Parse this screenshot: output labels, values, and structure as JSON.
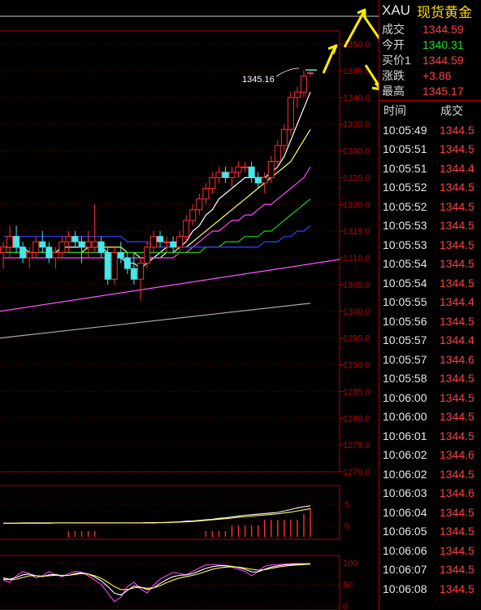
{
  "quote": {
    "code": "XAU",
    "name": "现货黄金",
    "rows": [
      {
        "label": "成交",
        "value": "1344.59",
        "color": "#ff4040"
      },
      {
        "label": "今开",
        "value": "1340.31",
        "color": "#22dd22"
      },
      {
        "label": "买价1",
        "value": "1344.59",
        "color": "#ff4040"
      },
      {
        "label": "涨跌",
        "value": "+3.86",
        "color": "#ff4040"
      },
      {
        "label": "最高",
        "value": "1345.17",
        "color": "#ff4040"
      }
    ]
  },
  "ticks": {
    "col_time": "时间",
    "col_price": "成交",
    "rows": [
      {
        "time": "10:05:49",
        "price": "1344.5"
      },
      {
        "time": "10:05:51",
        "price": "1344.5"
      },
      {
        "time": "10:05:51",
        "price": "1344.4"
      },
      {
        "time": "10:05:52",
        "price": "1344.5"
      },
      {
        "time": "10:05:52",
        "price": "1344.5"
      },
      {
        "time": "10:05:53",
        "price": "1344.5"
      },
      {
        "time": "10:05:53",
        "price": "1344.5"
      },
      {
        "time": "10:05:54",
        "price": "1344.5"
      },
      {
        "time": "10:05:54",
        "price": "1344.5"
      },
      {
        "time": "10:05:55",
        "price": "1344.4"
      },
      {
        "time": "10:05:56",
        "price": "1344.5"
      },
      {
        "time": "10:05:57",
        "price": "1344.4"
      },
      {
        "time": "10:05:57",
        "price": "1344.6"
      },
      {
        "time": "10:05:58",
        "price": "1344.5"
      },
      {
        "time": "10:06:00",
        "price": "1344.5"
      },
      {
        "time": "10:06:00",
        "price": "1344.5"
      },
      {
        "time": "10:06:01",
        "price": "1344.5"
      },
      {
        "time": "10:06:02",
        "price": "1344.6"
      },
      {
        "time": "10:06:02",
        "price": "1344.5"
      },
      {
        "time": "10:06:03",
        "price": "1344.6"
      },
      {
        "time": "10:06:04",
        "price": "1344.5"
      },
      {
        "time": "10:06:05",
        "price": "1344.5"
      },
      {
        "time": "10:06:06",
        "price": "1344.5"
      },
      {
        "time": "10:06:07",
        "price": "1344.5"
      },
      {
        "time": "10:06:08",
        "price": "1344.5"
      }
    ]
  },
  "chart_data": {
    "type": "candlestick",
    "price_axis": {
      "ticks": [
        "1350.0",
        "1345.0",
        "1340.0",
        "1335.0",
        "1330.0",
        "1325.0",
        "1320.0",
        "1315.0",
        "1310.0",
        "1305.0",
        "1300.0",
        "1295.0",
        "1290.0",
        "1285.0",
        "1280.0",
        "1275.0",
        "1270.0"
      ],
      "min": 1270,
      "max": 1350
    },
    "high_annotation": "1345.16",
    "candles": [
      [
        1311,
        1313,
        1308,
        1312
      ],
      [
        1312,
        1316,
        1310,
        1314
      ],
      [
        1314,
        1316,
        1311,
        1312
      ],
      [
        1312,
        1313,
        1309,
        1310
      ],
      [
        1310,
        1312,
        1308,
        1311
      ],
      [
        1311,
        1314,
        1310,
        1313
      ],
      [
        1313,
        1315,
        1311,
        1312
      ],
      [
        1312,
        1313,
        1309,
        1310
      ],
      [
        1310,
        1312,
        1308,
        1311
      ],
      [
        1311,
        1314,
        1310,
        1313
      ],
      [
        1313,
        1315,
        1311,
        1314
      ],
      [
        1314,
        1315,
        1312,
        1313
      ],
      [
        1313,
        1314,
        1309,
        1312
      ],
      [
        1312,
        1315,
        1310,
        1313
      ],
      [
        1312,
        1320,
        1311,
        1313
      ],
      [
        1313,
        1314,
        1310,
        1311
      ],
      [
        1311,
        1312,
        1305,
        1306
      ],
      [
        1306,
        1312,
        1305,
        1311
      ],
      [
        1311,
        1313,
        1309,
        1310
      ],
      [
        1310,
        1311,
        1307,
        1308
      ],
      [
        1308,
        1311,
        1305,
        1306
      ],
      [
        1306,
        1310,
        1302,
        1309
      ],
      [
        1309,
        1313,
        1308,
        1312
      ],
      [
        1312,
        1315,
        1311,
        1314
      ],
      [
        1314,
        1315,
        1312,
        1313
      ],
      [
        1313,
        1314,
        1311,
        1313
      ],
      [
        1313,
        1314,
        1311,
        1312
      ],
      [
        1312,
        1315,
        1311,
        1314
      ],
      [
        1314,
        1318,
        1313,
        1317
      ],
      [
        1317,
        1320,
        1316,
        1319
      ],
      [
        1319,
        1322,
        1318,
        1321
      ],
      [
        1321,
        1324,
        1320,
        1323
      ],
      [
        1323,
        1326,
        1322,
        1325
      ],
      [
        1325,
        1327,
        1324,
        1326
      ],
      [
        1326,
        1327,
        1324,
        1325
      ],
      [
        1325,
        1327,
        1323,
        1326
      ],
      [
        1326,
        1328,
        1325,
        1327
      ],
      [
        1327,
        1328,
        1326,
        1327
      ],
      [
        1327,
        1328,
        1324,
        1325
      ],
      [
        1325,
        1326,
        1323,
        1324
      ],
      [
        1324,
        1326,
        1322,
        1325
      ],
      [
        1325,
        1329,
        1324,
        1328
      ],
      [
        1328,
        1332,
        1327,
        1331
      ],
      [
        1331,
        1335,
        1330,
        1334
      ],
      [
        1334,
        1341,
        1333,
        1340
      ],
      [
        1340,
        1342,
        1338,
        1341
      ],
      [
        1341,
        1345,
        1340,
        1344
      ],
      [
        1344.5,
        1345,
        1344,
        1344.6
      ]
    ],
    "moving_averages": [
      {
        "color": "#ffffff",
        "values": [
          1312,
          1312,
          1312,
          1312,
          1311,
          1311,
          1311,
          1311,
          1311,
          1312,
          1312,
          1312,
          1312,
          1312,
          1312,
          1312,
          1311,
          1310,
          1310,
          1309,
          1309,
          1308,
          1309,
          1310,
          1311,
          1312,
          1312,
          1312,
          1313,
          1315,
          1316,
          1318,
          1319,
          1321,
          1322,
          1323,
          1324,
          1325,
          1325,
          1325,
          1325,
          1326,
          1327,
          1329,
          1332,
          1335,
          1338,
          1341
        ]
      },
      {
        "color": "#ffff60",
        "values": [
          1311,
          1311,
          1311,
          1311,
          1311,
          1311,
          1311,
          1311,
          1311,
          1311,
          1311,
          1311,
          1311,
          1312,
          1312,
          1312,
          1312,
          1312,
          1312,
          1311,
          1311,
          1310,
          1310,
          1310,
          1310,
          1311,
          1311,
          1312,
          1312,
          1313,
          1314,
          1315,
          1316,
          1317,
          1318,
          1319,
          1320,
          1321,
          1322,
          1323,
          1324,
          1325,
          1326,
          1327,
          1328,
          1330,
          1332,
          1334
        ]
      },
      {
        "color": "#ff44ff",
        "values": [
          1310,
          1310,
          1310,
          1310,
          1310,
          1310,
          1310,
          1310,
          1310,
          1310,
          1310,
          1310,
          1310,
          1310,
          1310,
          1310,
          1310,
          1310,
          1310,
          1310,
          1310,
          1310,
          1310,
          1310,
          1310,
          1310,
          1310,
          1311,
          1311,
          1312,
          1313,
          1314,
          1315,
          1315,
          1316,
          1317,
          1317,
          1318,
          1318,
          1319,
          1320,
          1320,
          1321,
          1322,
          1323,
          1324,
          1325,
          1327
        ]
      },
      {
        "color": "#22cc22",
        "values": [
          1311,
          1311,
          1311,
          1311,
          1311,
          1311,
          1311,
          1311,
          1311,
          1311,
          1311,
          1311,
          1311,
          1311,
          1311,
          1311,
          1311,
          1311,
          1311,
          1311,
          1311,
          1311,
          1311,
          1311,
          1311,
          1311,
          1311,
          1311,
          1311,
          1311,
          1311,
          1312,
          1312,
          1312,
          1313,
          1313,
          1313,
          1314,
          1314,
          1314,
          1315,
          1315,
          1316,
          1317,
          1318,
          1319,
          1320,
          1321
        ]
      },
      {
        "color": "#3344ff",
        "values": [
          1314,
          1314,
          1314,
          1314,
          1314,
          1314,
          1314,
          1314,
          1314,
          1314,
          1314,
          1314,
          1314,
          1314,
          1314,
          1314,
          1314,
          1314,
          1314,
          1313,
          1313,
          1313,
          1313,
          1312,
          1312,
          1312,
          1312,
          1312,
          1312,
          1312,
          1312,
          1312,
          1312,
          1312,
          1312,
          1312,
          1312,
          1312,
          1312,
          1312,
          1313,
          1313,
          1313,
          1314,
          1314,
          1315,
          1315,
          1316
        ]
      }
    ],
    "trend_lines": [
      {
        "color": "#ff55ff",
        "from": 1300.0,
        "to": 1309.7
      },
      {
        "color": "#aaaaaa",
        "from": 1295.0,
        "to": 1301.5
      }
    ],
    "volume_axis": {
      "ticks": [
        "5",
        "0"
      ]
    },
    "volume_values": [
      0,
      0,
      0,
      0,
      0,
      0,
      0,
      0,
      0,
      0,
      1,
      1,
      1,
      1,
      1,
      0,
      0,
      0,
      0,
      0,
      0,
      0,
      0,
      0,
      0,
      0,
      0,
      0,
      0,
      0,
      0,
      1,
      1,
      1,
      1,
      2,
      2,
      2,
      2,
      2,
      3,
      3,
      3,
      3,
      3,
      3,
      4,
      5
    ],
    "volume_lines": [
      {
        "color": "#ffffff",
        "values": [
          0.2,
          0.2,
          0.2,
          0.3,
          0.3,
          0.3,
          0.3,
          0.3,
          0.3,
          0.3,
          0.3,
          0.3,
          0.3,
          0.3,
          0.3,
          0.3,
          0.3,
          0.3,
          0.3,
          0.3,
          0.3,
          0.3,
          0.4,
          0.4,
          0.4,
          0.5,
          0.6,
          0.7,
          0.9,
          1.0,
          1.2,
          1.4,
          1.6,
          1.9,
          2.1,
          2.4,
          2.7,
          3.0,
          3.2,
          3.4,
          3.6,
          3.8,
          4.0,
          4.5,
          5.0,
          5.6,
          6.0,
          6.3
        ]
      },
      {
        "color": "#ffff60",
        "values": [
          0.2,
          0.2,
          0.2,
          0.2,
          0.2,
          0.2,
          0.2,
          0.2,
          0.3,
          0.3,
          0.3,
          0.3,
          0.3,
          0.3,
          0.3,
          0.3,
          0.3,
          0.3,
          0.3,
          0.3,
          0.3,
          0.3,
          0.3,
          0.3,
          0.4,
          0.4,
          0.5,
          0.6,
          0.7,
          0.8,
          1.0,
          1.2,
          1.4,
          1.6,
          1.8,
          2.0,
          2.3,
          2.5,
          2.7,
          2.9,
          3.1,
          3.3,
          3.5,
          3.8,
          4.1,
          4.5,
          4.9,
          5.3
        ]
      }
    ],
    "osc_axis": {
      "ticks": [
        "100",
        "50",
        "0"
      ]
    },
    "osc_lines": [
      {
        "color": "#ff44ff",
        "values": [
          60,
          55,
          70,
          80,
          75,
          65,
          70,
          80,
          72,
          68,
          75,
          80,
          78,
          70,
          60,
          50,
          30,
          10,
          20,
          45,
          55,
          40,
          30,
          48,
          62,
          70,
          78,
          75,
          72,
          80,
          88,
          95,
          96,
          95,
          94,
          90,
          85,
          80,
          70,
          80,
          92,
          95,
          96,
          97,
          98,
          98,
          98,
          98
        ]
      },
      {
        "color": "#ffffff",
        "values": [
          65,
          62,
          66,
          72,
          74,
          70,
          68,
          72,
          73,
          70,
          71,
          75,
          77,
          74,
          67,
          58,
          45,
          30,
          25,
          36,
          46,
          44,
          38,
          42,
          52,
          61,
          68,
          71,
          72,
          75,
          81,
          87,
          91,
          93,
          93,
          92,
          89,
          85,
          79,
          79,
          85,
          90,
          93,
          95,
          96,
          97,
          97,
          98
        ]
      },
      {
        "color": "#ffff60",
        "values": [
          62,
          61,
          62,
          66,
          70,
          70,
          69,
          70,
          71,
          71,
          71,
          73,
          75,
          74,
          70,
          64,
          55,
          45,
          38,
          38,
          42,
          43,
          41,
          42,
          47,
          54,
          60,
          65,
          68,
          71,
          75,
          80,
          85,
          88,
          90,
          91,
          90,
          88,
          85,
          83,
          84,
          87,
          90,
          92,
          94,
          95,
          96,
          97
        ]
      }
    ]
  }
}
